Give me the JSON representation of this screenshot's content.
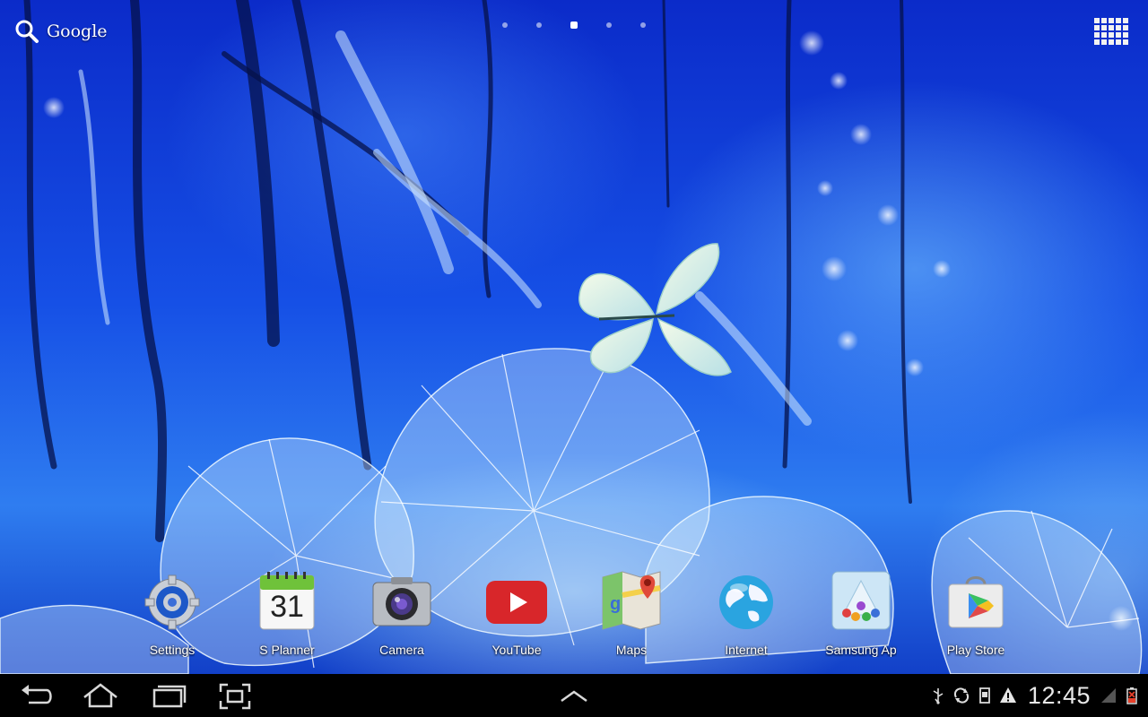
{
  "search": {
    "label": "Google"
  },
  "page_indicator": {
    "count": 5,
    "active_index": 2
  },
  "dock": {
    "apps": [
      {
        "id": "settings",
        "label": "Settings"
      },
      {
        "id": "splanner",
        "label": "S Planner",
        "date_number": "31"
      },
      {
        "id": "camera",
        "label": "Camera"
      },
      {
        "id": "youtube",
        "label": "YouTube"
      },
      {
        "id": "maps",
        "label": "Maps"
      },
      {
        "id": "internet",
        "label": "Internet"
      },
      {
        "id": "samsung-apps",
        "label": "Samsung Ap"
      },
      {
        "id": "play-store",
        "label": "Play Store"
      }
    ]
  },
  "system_bar": {
    "clock": "12:45"
  },
  "colors": {
    "youtube_red": "#d8262a",
    "planner_green": "#6fc23a",
    "battery_low": "#e8402a"
  }
}
